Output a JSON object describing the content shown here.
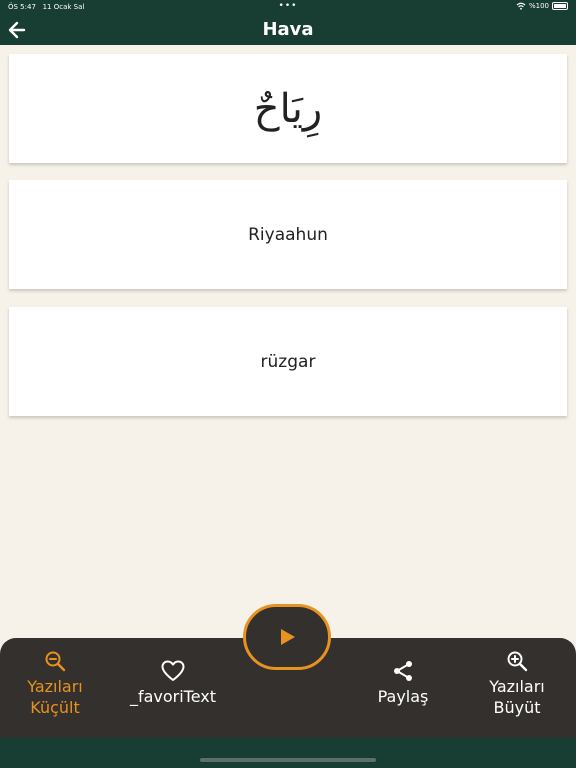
{
  "status": {
    "time": "ÖS 5:47",
    "date": "11 Ocak Sal",
    "battery": "%100",
    "dots": "•••"
  },
  "header": {
    "title": "Hava"
  },
  "cards": {
    "arabic": "رِيَاحٌ",
    "transliteration": "Riyaahun",
    "meaning": "rüzgar"
  },
  "bottom_nav": {
    "shrink_line1": "Yazıları",
    "shrink_line2": "Küçült",
    "favorite": "_favoriText",
    "share": "Paylaş",
    "grow_line1": "Yazıları",
    "grow_line2": "Büyüt"
  },
  "colors": {
    "header_bg": "#183e33",
    "page_bg": "#f6f1e9",
    "bar_bg": "#33302d",
    "accent": "#e8921f"
  },
  "icons": [
    "back-arrow-icon",
    "zoom-out-icon",
    "heart-icon",
    "play-icon",
    "share-icon",
    "zoom-in-icon",
    "wifi-icon",
    "battery-icon"
  ]
}
